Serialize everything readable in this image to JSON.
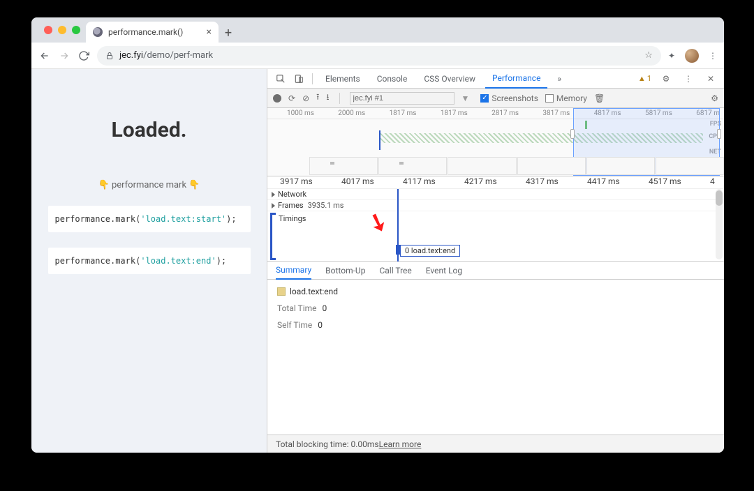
{
  "browser": {
    "tab_title": "performance.mark()",
    "url_host": "jec.fyi",
    "url_path": "/demo/perf-mark"
  },
  "page": {
    "heading": "Loaded.",
    "caption": "👇 performance mark 👇",
    "code1_prefix": "performance.mark(",
    "code1_str": "'load.text:start'",
    "code1_suffix": ");",
    "code2_prefix": "performance.mark(",
    "code2_str": "'load.text:end'",
    "code2_suffix": ");"
  },
  "devtools": {
    "tabs": {
      "elements": "Elements",
      "console": "Console",
      "css": "CSS Overview",
      "performance": "Performance"
    },
    "warnings": "1",
    "perf_toolbar": {
      "recording_name": "jec.fyi #1",
      "screenshots_label": "Screenshots",
      "memory_label": "Memory"
    },
    "overview_ticks": [
      "1000 ms",
      "2000 ms",
      "1817 ms",
      "1817 ms",
      "2817 ms",
      "3817 ms",
      "4817 ms",
      "5817 ms",
      "6817 m"
    ],
    "overview_labels": {
      "fps": "FPS",
      "cpu": "CPU",
      "net": "NET"
    },
    "detail_ticks": [
      "3917 ms",
      "4017 ms",
      "4117 ms",
      "4217 ms",
      "4317 ms",
      "4417 ms",
      "4517 ms",
      "4"
    ],
    "detail_rows": {
      "network": "Network",
      "frames": "Frames",
      "frames_val": "3935.1 ms",
      "timings": "Timings"
    },
    "marker_label": "0 load.text:end",
    "bottom_tabs": {
      "summary": "Summary",
      "bottomup": "Bottom-Up",
      "calltree": "Call Tree",
      "eventlog": "Event Log"
    },
    "summary": {
      "name": "load.text:end",
      "total_label": "Total Time",
      "total_val": "0",
      "self_label": "Self Time",
      "self_val": "0"
    },
    "statusbar": {
      "text": "Total blocking time: 0.00ms ",
      "link": "Learn more"
    }
  }
}
